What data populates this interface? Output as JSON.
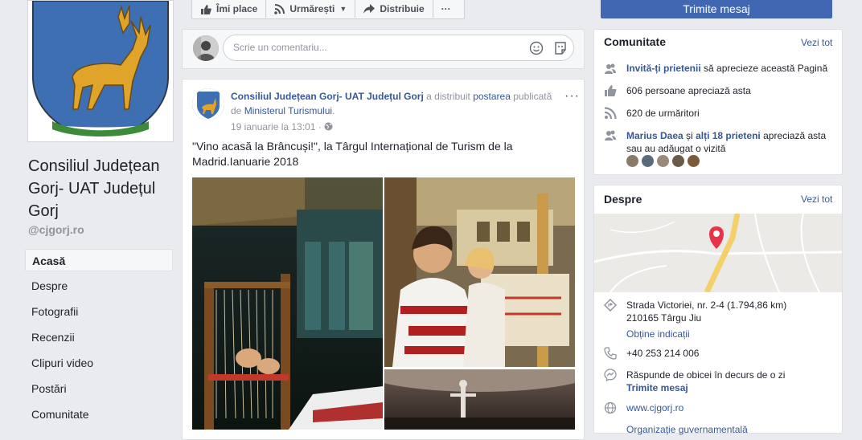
{
  "page": {
    "name": "Consiliul Județean Gorj- UAT Județul Gorj",
    "handle": "@cjgorj.ro"
  },
  "nav": [
    {
      "label": "Acasă",
      "active": true
    },
    {
      "label": "Despre"
    },
    {
      "label": "Fotografii"
    },
    {
      "label": "Recenzii"
    },
    {
      "label": "Clipuri video"
    },
    {
      "label": "Postări"
    },
    {
      "label": "Comunitate"
    }
  ],
  "actions": {
    "like": "Îmi place",
    "follow": "Urmărești",
    "share": "Distribuie",
    "more": "···",
    "send_message": "Trimite mesaj"
  },
  "comment": {
    "placeholder": "Scrie un comentariu..."
  },
  "post": {
    "author": "Consiliul Județean Gorj- UAT Județul Gorj",
    "shared_text": "a distribuit",
    "post_link": "postarea",
    "published_by": "publicată de",
    "source": "Ministerul Turismului",
    "period": ".",
    "time": "19 ianuarie la 13:01 ·",
    "text": "\"Vino acasă la Brâncuși!\", la Târgul Internațional de Turism de la Madrid.Ianuarie 2018",
    "menu": "···"
  },
  "community": {
    "title": "Comunitate",
    "see_all": "Vezi tot",
    "invite_link": "Invită-ți prietenii",
    "invite_rest": "să aprecieze această Pagină",
    "likes": "606 persoane apreciază asta",
    "follows": "620 de urmăritori",
    "friend_name": "Marius Daea",
    "friend_and": "și",
    "friend_others": "alți 18 prieteni",
    "friend_rest": "apreciază asta sau au adăugat o vizită"
  },
  "about": {
    "title": "Despre",
    "see_all": "Vezi tot",
    "address_line1": "Strada Victoriei, nr. 2-4 (1.794,86 km)",
    "address_line2": "210165 Târgu Jiu",
    "directions": "Obține indicații",
    "phone": "+40 253 214 006",
    "response": "Răspunde de obicei în decurs de o zi",
    "send_message": "Trimite mesaj",
    "website": "www.cjgorj.ro",
    "category": "Organizație guvernamentală"
  },
  "colors": {
    "brand": "#4267b2",
    "link": "#365899",
    "background": "#e9ebee"
  }
}
